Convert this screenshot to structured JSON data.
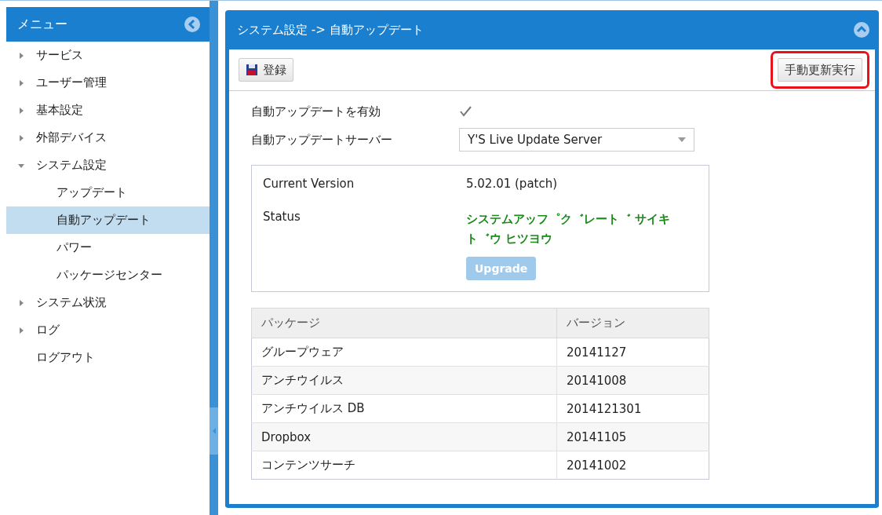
{
  "sidebar": {
    "title": "メニュー",
    "items": [
      {
        "label": "サービス",
        "expanded": false,
        "selected": false
      },
      {
        "label": "ユーザー管理",
        "expanded": false,
        "selected": false
      },
      {
        "label": "基本設定",
        "expanded": false,
        "selected": false
      },
      {
        "label": "外部デバイス",
        "expanded": false,
        "selected": false
      },
      {
        "label": "システム設定",
        "expanded": true,
        "selected": false,
        "children": [
          {
            "label": "アップデート",
            "selected": false
          },
          {
            "label": "自動アップデート",
            "selected": true
          },
          {
            "label": "パワー",
            "selected": false
          },
          {
            "label": "パッケージセンター",
            "selected": false
          }
        ]
      },
      {
        "label": "システム状況",
        "expanded": false,
        "selected": false
      },
      {
        "label": "ログ",
        "expanded": false,
        "selected": false
      },
      {
        "label": "ログアウト",
        "selected": false
      }
    ]
  },
  "panel": {
    "title": "システム設定 -> 自動アップデート",
    "toolbar": {
      "save": "登録",
      "manual": {
        "label": "手動更新実行",
        "highlighted": true
      }
    },
    "form": {
      "enable_label": "自動アップデートを有効",
      "enable_checked": true,
      "server_label": "自動アップデートサーバー",
      "server_value": "Y'S Live Update Server"
    },
    "info": {
      "version_label": "Current Version",
      "version": "5.02.01 (patch)",
      "status_label": "Status",
      "status": "システムアッフ゜ク゛レート゛ サイキト゛ウ ヒツヨウ",
      "upgrade": {
        "label": "Upgrade",
        "disabled": true
      }
    },
    "table": {
      "columns": [
        "パッケージ",
        "バージョン"
      ],
      "rows": [
        [
          "グループウェア",
          "20141127"
        ],
        [
          "アンチウイルス",
          "20141008"
        ],
        [
          "アンチウイルス DB",
          "2014121301"
        ],
        [
          "Dropbox",
          "20141105"
        ],
        [
          "コンテンツサーチ",
          "20141002"
        ]
      ]
    }
  }
}
